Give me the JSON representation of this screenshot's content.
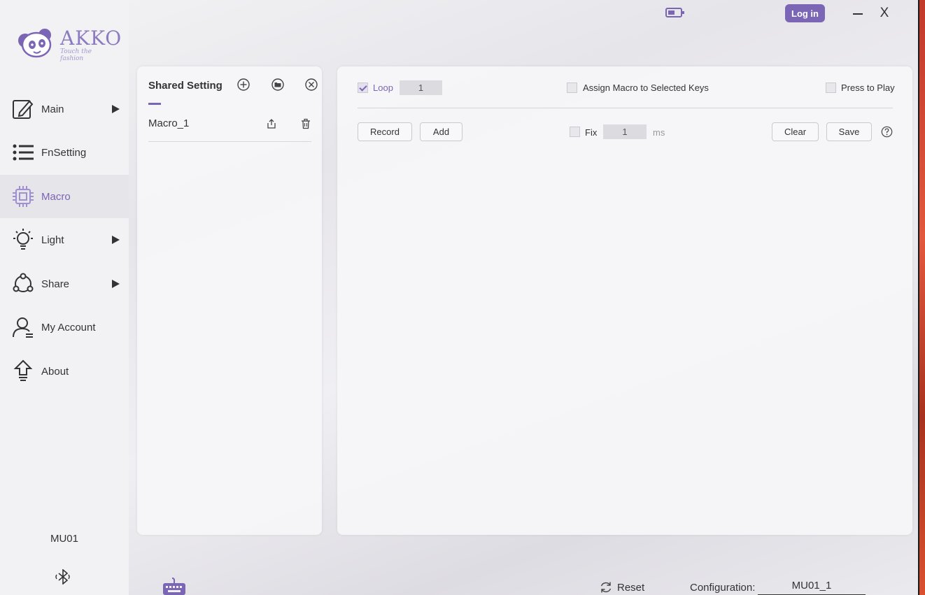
{
  "brand": {
    "logo_text": "AKKO",
    "logo_tagline": "Touch the fashion",
    "accent": "#7b65b5"
  },
  "topbar": {
    "login_label": "Log in",
    "close_label": "X"
  },
  "sidebar": {
    "items": [
      {
        "label": "Main",
        "icon": "pencil-square-icon",
        "has_submenu": true
      },
      {
        "label": "FnSetting",
        "icon": "list-icon",
        "has_submenu": false
      },
      {
        "label": "Macro",
        "icon": "chip-icon",
        "has_submenu": false,
        "active": true
      },
      {
        "label": "Light",
        "icon": "light-bulb-icon",
        "has_submenu": true
      },
      {
        "label": "Share",
        "icon": "share-icon",
        "has_submenu": true
      },
      {
        "label": "My Account",
        "icon": "user-icon",
        "has_submenu": false
      },
      {
        "label": "About",
        "icon": "upload-arrow-icon",
        "has_submenu": false
      }
    ],
    "device_name": "MU01"
  },
  "shared_panel": {
    "title": "Shared Setting",
    "macros": [
      {
        "name": "Macro_1"
      }
    ]
  },
  "macro_editor": {
    "loop_label": "Loop",
    "loop_checked": true,
    "loop_count": "1",
    "assign_label": "Assign Macro to Selected Keys",
    "assign_checked": false,
    "press_to_play_label": "Press to Play",
    "press_to_play_checked": false,
    "record_label": "Record",
    "add_label": "Add",
    "fix_label": "Fix",
    "fix_checked": false,
    "fix_value": "1",
    "fix_unit": "ms",
    "clear_label": "Clear",
    "save_label": "Save"
  },
  "bottombar": {
    "reset_label": "Reset",
    "config_label": "Configuration:",
    "config_value": "MU01_1"
  }
}
